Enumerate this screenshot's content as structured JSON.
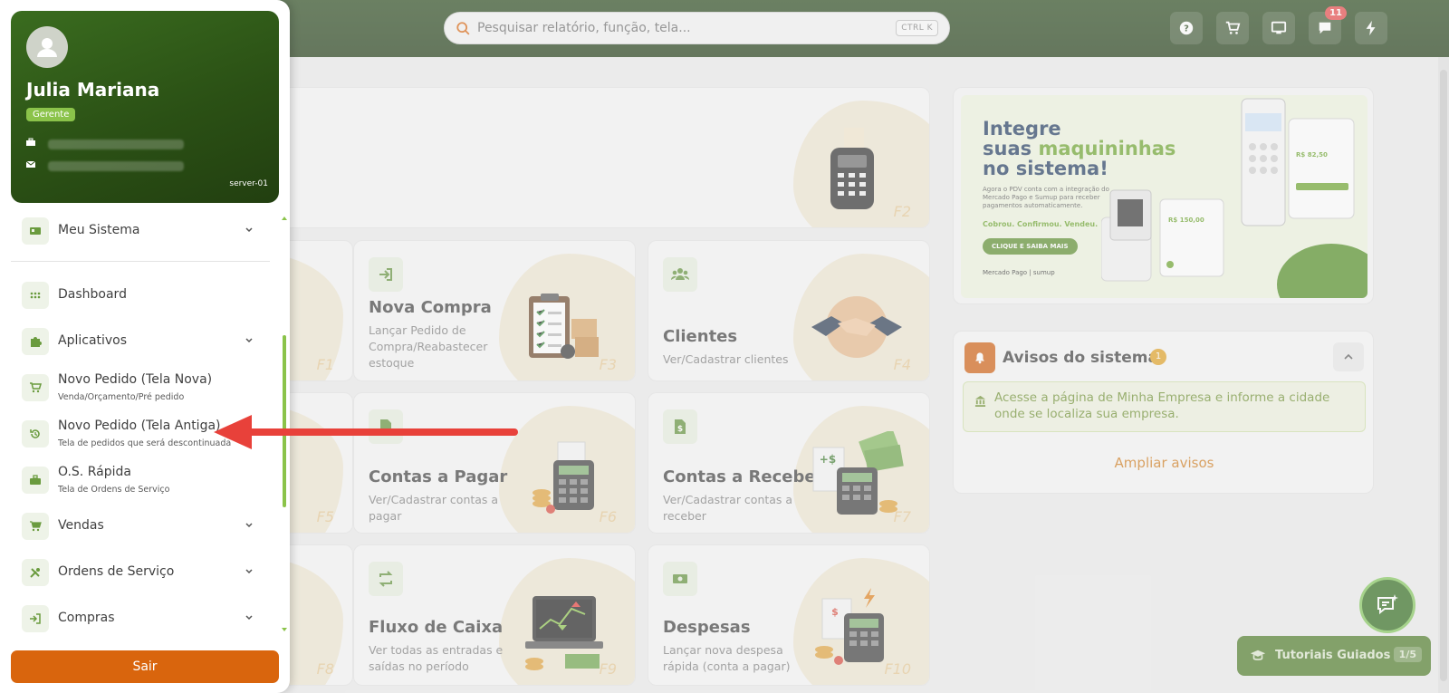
{
  "topbar": {
    "search_placeholder": "Pesquisar relatório, função, tela...",
    "search_shortcut": "CTRL K",
    "notifications_count": "11"
  },
  "cards": [
    {
      "title": "Nova Compra",
      "desc": "Lançar Pedido de Compra/Reabastecer estoque",
      "key": "F3"
    },
    {
      "title": "Clientes",
      "desc": "Ver/Cadastrar clientes",
      "key": "F4"
    },
    {
      "title": "Contas a Pagar",
      "desc": "Ver/Cadastrar contas a pagar",
      "key": "F6"
    },
    {
      "title": "Contas a Receber",
      "desc": "Ver/Cadastrar contas a receber",
      "key": "F7"
    },
    {
      "title": "Fluxo de Caixa",
      "desc": "Ver todas as entradas e saídas no período",
      "key": "F9"
    },
    {
      "title": "Despesas",
      "desc": "Lançar nova despesa rápida (conta a pagar)",
      "key": "F10"
    }
  ],
  "partial_keys": [
    "F2",
    "F1",
    "F5",
    "F8"
  ],
  "banner": {
    "line1": "Integre",
    "line2a": "suas ",
    "line2b": "maquininhas",
    "line3": "no sistema!",
    "text": "Agora o PDV conta com a integração do Mercado Pago e Sumup para receber pagamentos automaticamente.",
    "tagline": "Cobrou. Confirmou. Vendeu.",
    "cta": "CLIQUE E SAIBA MAIS",
    "logos": "Mercado Pago | sumup",
    "value1": "R$ 150,00",
    "value2": "R$ 82,50"
  },
  "avisos": {
    "title": "Avisos do sistema",
    "count": "1",
    "message": "Acesse a página de Minha Empresa e informe a cidade onde se localiza sua empresa.",
    "more": "Ampliar avisos"
  },
  "tutorials": {
    "label": "Tutoriais Guiados",
    "count": "1/5"
  },
  "profile": {
    "name": "Julia Mariana",
    "role": "Gerente",
    "server": "server-01"
  },
  "menu": {
    "meu_sistema": "Meu Sistema",
    "dashboard": "Dashboard",
    "aplicativos": "Aplicativos",
    "novo_pedido_nova": "Novo Pedido (Tela Nova)",
    "novo_pedido_nova_sub": "Venda/Orçamento/Pré pedido",
    "novo_pedido_antiga": "Novo Pedido (Tela Antiga)",
    "novo_pedido_antiga_sub": "Tela de pedidos que será descontinuada",
    "os_rapida": "O.S. Rápida",
    "os_rapida_sub": "Tela de Ordens de Serviço",
    "vendas": "Vendas",
    "ordens": "Ordens de Serviço",
    "compras": "Compras"
  },
  "sair": "Sair",
  "colors": {
    "brand_green": "#2b5115",
    "accent_orange": "#d9650d",
    "annotation_red": "#e8413a"
  }
}
